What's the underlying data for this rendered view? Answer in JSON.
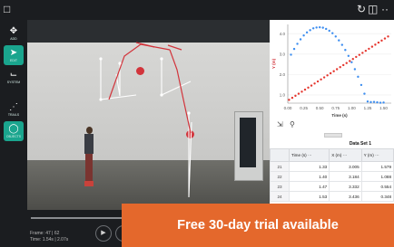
{
  "topbar": {
    "menu_icon": "document-icon",
    "undo_icon": "refresh-icon",
    "layout_icon": "layout-icon"
  },
  "sidebar": {
    "tools": [
      {
        "name": "add",
        "label": "ADD",
        "icon": "crosshair-icon"
      },
      {
        "name": "edit",
        "label": "EDIT",
        "icon": "cursor-icon"
      },
      {
        "name": "system",
        "label": "SYSTEM",
        "icon": "axes-icon"
      },
      {
        "name": "trails",
        "label": "TRAILS",
        "icon": "trail-icon"
      },
      {
        "name": "objects",
        "label": "OBJECTS",
        "icon": "objects-icon"
      }
    ]
  },
  "video_controls": {
    "frame_text": "Frame: 47 | 62",
    "time_text": "Time: 1.54s | 2.07s",
    "play_icon": "play-icon",
    "progress": 0.758
  },
  "promo": {
    "text": "Free 30-day trial available"
  },
  "chart_data": {
    "type": "scatter",
    "xlabel": "Time (s)",
    "ylabel": "Y (m)",
    "x_ticks": [
      "0.00",
      "0.25",
      "0.50",
      "0.75",
      "1.00",
      "1.25",
      "1.50",
      "1."
    ],
    "y_ticks": [
      "1.0",
      "2.0",
      "3.0",
      "4.0"
    ],
    "xlim": [
      0,
      1.62
    ],
    "ylim": [
      0.6,
      4.45
    ],
    "series": [
      {
        "color": "#3d8ef0",
        "x": [
          0.05,
          0.1,
          0.15,
          0.2,
          0.25,
          0.3,
          0.35,
          0.4,
          0.45,
          0.5,
          0.55,
          0.6,
          0.65,
          0.7,
          0.75,
          0.8,
          0.85,
          0.9,
          0.95,
          1.0,
          1.05,
          1.1,
          1.15,
          1.2,
          1.25,
          1.3,
          1.35,
          1.4,
          1.45,
          1.5
        ],
        "y": [
          2.97,
          3.25,
          3.5,
          3.72,
          3.91,
          4.06,
          4.17,
          4.26,
          4.3,
          4.31,
          4.29,
          4.23,
          4.14,
          4.02,
          3.86,
          3.67,
          3.45,
          3.2,
          2.91,
          2.6,
          2.26,
          1.89,
          1.49,
          1.06,
          0.68,
          0.65,
          0.66,
          0.64,
          0.62,
          0.63
        ]
      },
      {
        "color": "#e5372f",
        "x": [
          0.02,
          0.07,
          0.12,
          0.17,
          0.22,
          0.27,
          0.32,
          0.37,
          0.42,
          0.47,
          0.52,
          0.57,
          0.62,
          0.67,
          0.72,
          0.77,
          0.82,
          0.87,
          0.92,
          0.97,
          1.02,
          1.07,
          1.12,
          1.17,
          1.22,
          1.27,
          1.32,
          1.37,
          1.42,
          1.47,
          1.52,
          1.57
        ],
        "y": [
          0.76,
          0.86,
          0.96,
          1.06,
          1.16,
          1.26,
          1.36,
          1.46,
          1.56,
          1.66,
          1.76,
          1.86,
          1.96,
          2.06,
          2.16,
          2.26,
          2.36,
          2.46,
          2.56,
          2.66,
          2.76,
          2.86,
          2.96,
          3.06,
          3.16,
          3.26,
          3.36,
          3.46,
          3.56,
          3.66,
          3.76,
          3.86
        ]
      }
    ]
  },
  "chart_tools": {
    "scale_icon": "axis-scale-icon",
    "zoom_icon": "zoom-icon"
  },
  "table": {
    "title": "Data Set 1",
    "columns": [
      "Time (s)",
      "X (m)",
      "Y (m)"
    ],
    "rows": [
      {
        "n": "21",
        "t": "1.33",
        "x": "3.005",
        "y": "1.579"
      },
      {
        "n": "22",
        "t": "1.40",
        "x": "3.184",
        "y": "1.088"
      },
      {
        "n": "23",
        "t": "1.47",
        "x": "3.332",
        "y": "0.554"
      },
      {
        "n": "24",
        "t": "1.53",
        "x": "3.436",
        "y": "0.348"
      }
    ]
  }
}
